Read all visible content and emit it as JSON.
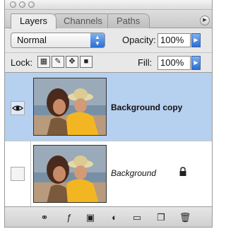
{
  "tabs": [
    {
      "label": "Layers",
      "active": true
    },
    {
      "label": "Channels",
      "active": false
    },
    {
      "label": "Paths",
      "active": false
    }
  ],
  "blend_mode": "Normal",
  "opacity": {
    "label": "Opacity:",
    "value": "100%"
  },
  "lock_label": "Lock:",
  "fill": {
    "label": "Fill:",
    "value": "100%"
  },
  "layers": [
    {
      "name": "Background copy",
      "visible": true,
      "selected": true,
      "locked": false
    },
    {
      "name": "Background",
      "visible": false,
      "selected": false,
      "locked": true
    }
  ],
  "icons": {
    "eye": "eye-icon",
    "lock": "lock-icon",
    "panel_menu": "panel-menu-icon",
    "toolbar": [
      "link-layers-icon",
      "layer-style-icon",
      "layer-mask-icon",
      "adjustment-layer-icon",
      "new-group-icon",
      "new-layer-icon",
      "trash-icon"
    ]
  },
  "colors": {
    "selected_row": "#b6d0f0",
    "accent": "#2a6fd6"
  }
}
